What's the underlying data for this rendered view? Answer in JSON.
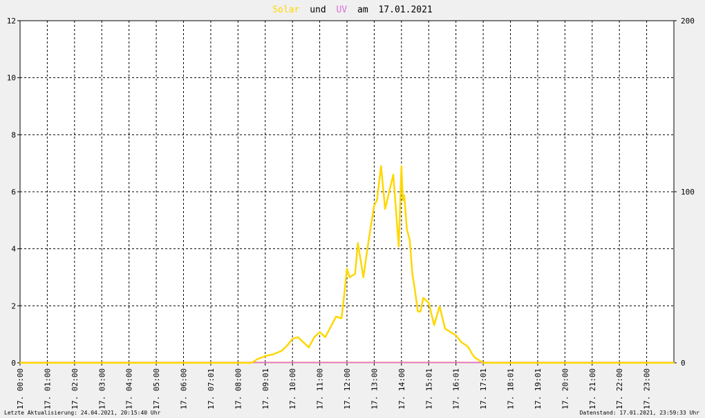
{
  "header": {
    "solar_label": "Solar",
    "und_label": "und",
    "uv_label": "UV",
    "am_label": "am",
    "date": "17.01.2021"
  },
  "footer": {
    "last_update": "Letzte Aktualisierung: 24.04.2021, 20:15:40 Uhr",
    "data_status": "Datenstand: 17.01.2021, 23:59:33 Uhr"
  },
  "colors": {
    "solar": "#ffd700",
    "uv": "#da70d6",
    "baseline": "#f08080",
    "grid": "#000000",
    "background": "#ffffff"
  },
  "chart_data": {
    "type": "line",
    "x_unit": "hours",
    "xlim": [
      0,
      24
    ],
    "x_ticks": [
      "17. 00:00",
      "17. 01:00",
      "17. 02:00",
      "17. 03:00",
      "17. 04:00",
      "17. 05:00",
      "17. 06:00",
      "17. 07:01",
      "17. 08:00",
      "17. 09:01",
      "17. 10:00",
      "17. 11:00",
      "17. 12:00",
      "17. 13:00",
      "17. 14:00",
      "17. 15:01",
      "17. 16:01",
      "17. 17:01",
      "17. 18:01",
      "17. 19:01",
      "17. 20:00",
      "17. 21:00",
      "17. 22:00",
      "17. 23:00"
    ],
    "y_left": {
      "lim": [
        0,
        12
      ],
      "ticks": [
        "0",
        "2",
        "4",
        "6",
        "8",
        "10",
        "12"
      ]
    },
    "y_right": {
      "lim": [
        0,
        200
      ],
      "ticks": [
        "0",
        "100",
        "200"
      ]
    },
    "grid": true,
    "series": [
      {
        "name": "Solar",
        "axis": "right",
        "x": [
          0,
          8.5,
          8.7,
          9.0,
          9.3,
          9.6,
          9.8,
          10.0,
          10.2,
          10.4,
          10.6,
          10.8,
          11.0,
          11.2,
          11.4,
          11.6,
          11.8,
          11.9,
          12.0,
          12.1,
          12.3,
          12.4,
          12.6,
          12.8,
          13.0,
          13.1,
          13.25,
          13.4,
          13.55,
          13.7,
          13.9,
          14.0,
          14.05,
          14.1,
          14.2,
          14.3,
          14.4,
          14.5,
          14.6,
          14.7,
          14.8,
          15.0,
          15.2,
          15.4,
          15.6,
          15.8,
          16.0,
          16.2,
          16.4,
          16.5,
          16.6,
          16.7,
          17.0,
          24
        ],
        "y": [
          0,
          0,
          2,
          4,
          5,
          7,
          10,
          14,
          15,
          12,
          9,
          15,
          18,
          15,
          21,
          27,
          26,
          40,
          55,
          50,
          52,
          70,
          50,
          72,
          92,
          95,
          115,
          90,
          100,
          110,
          68,
          115,
          95,
          98,
          78,
          72,
          52,
          42,
          30,
          30,
          38,
          35,
          22,
          33,
          20,
          18,
          16,
          12,
          10,
          8,
          5,
          3,
          0,
          0
        ]
      },
      {
        "name": "UV",
        "axis": "left",
        "x": [
          0,
          24
        ],
        "y": [
          0,
          0
        ]
      }
    ]
  }
}
